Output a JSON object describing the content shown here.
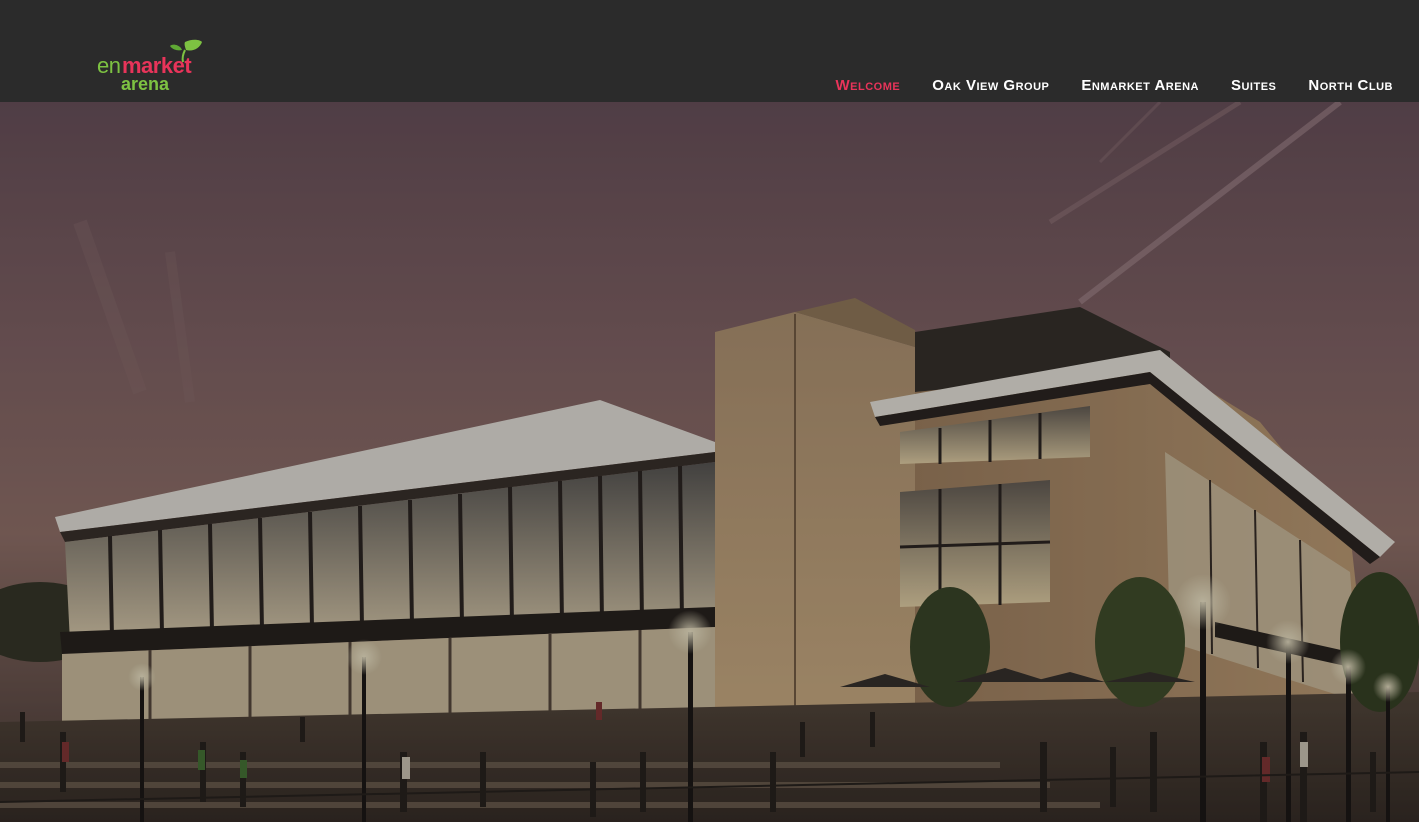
{
  "logo": {
    "line1_a": "en",
    "line1_b": "market",
    "line2": "arena",
    "colors": {
      "en": "#7dc242",
      "market": "#e8345a",
      "arena": "#7dc242",
      "leaf": "#7dc242"
    }
  },
  "nav": {
    "items": [
      {
        "label": "Welcome",
        "active": true
      },
      {
        "label": "Oak View Group",
        "active": false
      },
      {
        "label": "Enmarket Arena",
        "active": false
      },
      {
        "label": "Suites",
        "active": false
      },
      {
        "label": "North Club",
        "active": false
      }
    ]
  },
  "hero": {
    "icon": "arena-rendering-image"
  },
  "colors": {
    "header_bg": "#2b2b2b",
    "nav_text": "#ffffff",
    "nav_active": "#e8345a"
  }
}
